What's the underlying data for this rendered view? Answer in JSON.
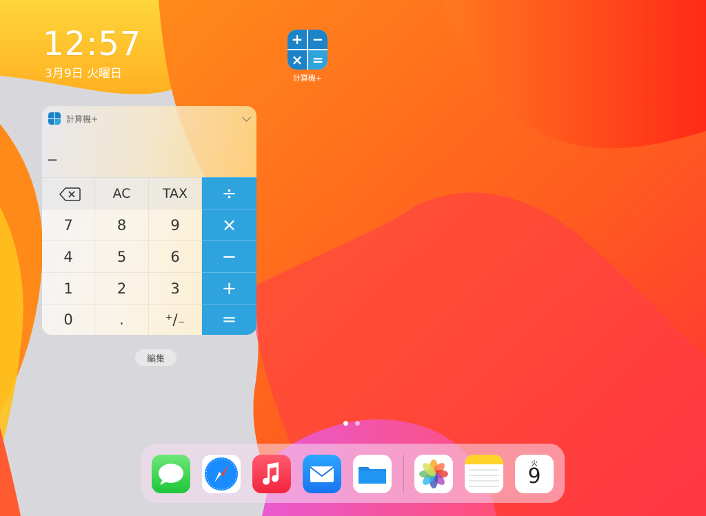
{
  "status": {
    "time": "12:57",
    "date": "3月9日 火曜日"
  },
  "home_app": {
    "label": "計算機+",
    "icon": "calculator-plus-icon",
    "symbols": [
      "+",
      "−",
      "×",
      "="
    ]
  },
  "widget": {
    "title": "計算機+",
    "display_value": "–",
    "keys": [
      {
        "label": "",
        "icon": "backspace-icon",
        "kind": "top"
      },
      {
        "label": "AC",
        "kind": "top"
      },
      {
        "label": "TAX",
        "kind": "top"
      },
      {
        "label": "÷",
        "kind": "op"
      },
      {
        "label": "7",
        "kind": "num"
      },
      {
        "label": "8",
        "kind": "num"
      },
      {
        "label": "9",
        "kind": "num"
      },
      {
        "label": "×",
        "kind": "op"
      },
      {
        "label": "4",
        "kind": "num"
      },
      {
        "label": "5",
        "kind": "num"
      },
      {
        "label": "6",
        "kind": "num"
      },
      {
        "label": "−",
        "kind": "op"
      },
      {
        "label": "1",
        "kind": "num"
      },
      {
        "label": "2",
        "kind": "num"
      },
      {
        "label": "3",
        "kind": "num"
      },
      {
        "label": "+",
        "kind": "op"
      },
      {
        "label": "0",
        "kind": "num"
      },
      {
        "label": ".",
        "kind": "num"
      },
      {
        "label": "⁺/₋",
        "kind": "num"
      },
      {
        "label": "=",
        "kind": "op"
      }
    ]
  },
  "edit_button": {
    "label": "編集"
  },
  "page_indicator": {
    "count": 2,
    "active": 0
  },
  "dock": {
    "apps": [
      "messages",
      "safari",
      "music",
      "mail",
      "files",
      "photos",
      "notes",
      "calendar"
    ],
    "calendar": {
      "weekday": "火",
      "day": "9"
    }
  },
  "colors": {
    "operator_key": "#2fa3de",
    "app_icon_blue": "#1d83c8"
  }
}
